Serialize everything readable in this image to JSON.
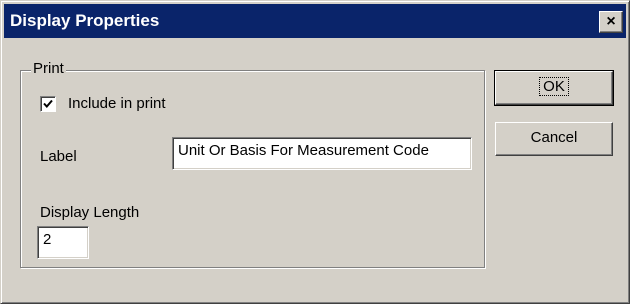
{
  "window": {
    "title": "Display Properties",
    "close_symbol": "×"
  },
  "print_group": {
    "title": "Print",
    "include_in_print": {
      "label": "Include in print",
      "checked": true
    },
    "label_field": {
      "label": "Label",
      "value": "Unit Or Basis For Measurement Code"
    },
    "display_length": {
      "label": "Display Length",
      "value": "2"
    }
  },
  "buttons": {
    "ok_label": "OK",
    "cancel_label": "Cancel"
  },
  "colors": {
    "titlebar": "#0a246a",
    "dialog_face": "#d4d0c8"
  },
  "icons": {
    "close": "close-icon",
    "check": "checkmark-icon"
  }
}
